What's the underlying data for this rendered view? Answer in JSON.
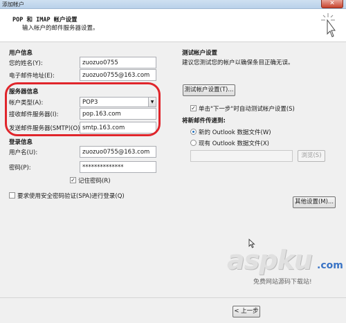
{
  "window": {
    "title": "添加帐户",
    "close_glyph": "✕"
  },
  "header": {
    "title": "POP 和 IMAP 帐户设置",
    "subtitle": "输入帐户的邮件服务器设置。"
  },
  "user_info": {
    "heading": "用户信息",
    "name_label": "您的姓名(Y):",
    "name_value": "zuozuo0755",
    "email_label": "电子邮件地址(E):",
    "email_value": "zuozuo0755@163.com"
  },
  "server_info": {
    "heading": "服务器信息",
    "type_label": "帐户类型(A):",
    "type_value": "POP3",
    "incoming_label": "接收邮件服务器(I):",
    "incoming_value": "pop.163.com",
    "outgoing_label": "发送邮件服务器(SMTP)(O):",
    "outgoing_value": "smtp.163.com"
  },
  "login_info": {
    "heading": "登录信息",
    "username_label": "用户名(U):",
    "username_value": "zuozuo0755@163.com",
    "password_label": "密码(P):",
    "password_value": "**************",
    "remember_label": "记住密码(R)",
    "remember_checked": "✓",
    "spa_label": "要求使用安全密码验证(SPA)进行登录(Q)"
  },
  "test_settings": {
    "heading": "测试帐户设置",
    "description": "建议您测试您的帐户以确保条目正确无误。",
    "test_button": "测试帐户设置(T)...",
    "auto_test_label": "单击\"下一步\"时自动测试帐户设置(S)",
    "auto_test_checked": "✓"
  },
  "delivery": {
    "heading": "将新邮件传递到:",
    "new_file_label": "新的 Outlook 数据文件(W)",
    "existing_file_label": "现有 Outlook 数据文件(X)",
    "browse_button": "浏览(S)"
  },
  "more_settings_button": "其他设置(M)...",
  "footer": {
    "prev_button": "< 上一步"
  },
  "watermark": {
    "brand": "aspku",
    "tld": ".com",
    "slogan": "免费网站源码下载站!"
  },
  "colors": {
    "highlight_ring": "#e0252b"
  }
}
